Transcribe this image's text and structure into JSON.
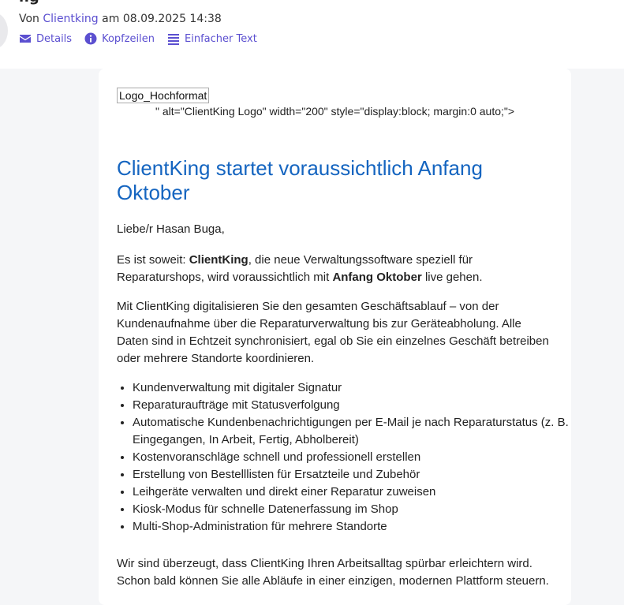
{
  "header": {
    "subject_partial": "ng",
    "from_prefix": "Von",
    "sender": "Clientking",
    "date_prefix": "am",
    "date": "08.09.2025 14:38",
    "actions": [
      {
        "label": "Details",
        "icon": "envelope-icon"
      },
      {
        "label": "Kopfzeilen",
        "icon": "info-icon"
      },
      {
        "label": "Einfacher Text",
        "icon": "lines-icon"
      }
    ]
  },
  "colors": {
    "link": "#5b4fd0",
    "title": "#1565c0"
  },
  "email": {
    "logo_alt_text": "Logo_Hochformat",
    "broken_html_text": "\" alt=\"ClientKing Logo\" width=\"200\" style=\"display:block; margin:0 auto;\">",
    "title": "ClientKing startet voraussichtlich Anfang Oktober",
    "greeting": "Liebe/r Hasan Buga,",
    "para1": {
      "t1": "Es ist soweit: ",
      "b1": "ClientKing",
      "t2": ", die neue Verwaltungssoftware speziell für Reparaturshops, wird voraussichtlich mit ",
      "b2": "Anfang Oktober",
      "t3": " live gehen."
    },
    "para2": "Mit ClientKing digitalisieren Sie den gesamten Geschäftsablauf – von der Kundenaufnahme über die Reparaturverwaltung bis zur Geräteabholung. Alle Daten sind in Echtzeit synchronisiert, egal ob Sie ein einzelnes Geschäft betreiben oder mehrere Standorte koordinieren.",
    "features": [
      "Kundenverwaltung mit digitaler Signatur",
      "Reparaturaufträge mit Statusverfolgung",
      "Automatische Kundenbenachrichtigungen per E-Mail je nach Reparaturstatus (z. B. Eingegangen, In Arbeit, Fertig, Abholbereit)",
      "Kostenvoranschläge schnell und professionell erstellen",
      "Erstellung von Bestelllisten für Ersatzteile und Zubehör",
      "Leihgeräte verwalten und direkt einer Reparatur zuweisen",
      "Kiosk-Modus für schnelle Datenerfassung im Shop",
      "Multi-Shop-Administration für mehrere Standorte"
    ],
    "para3": "Wir sind überzeugt, dass ClientKing Ihren Arbeitsalltag spürbar erleichtern wird. Schon bald können Sie alle Abläufe in einer einzigen, modernen Plattform steuern."
  }
}
